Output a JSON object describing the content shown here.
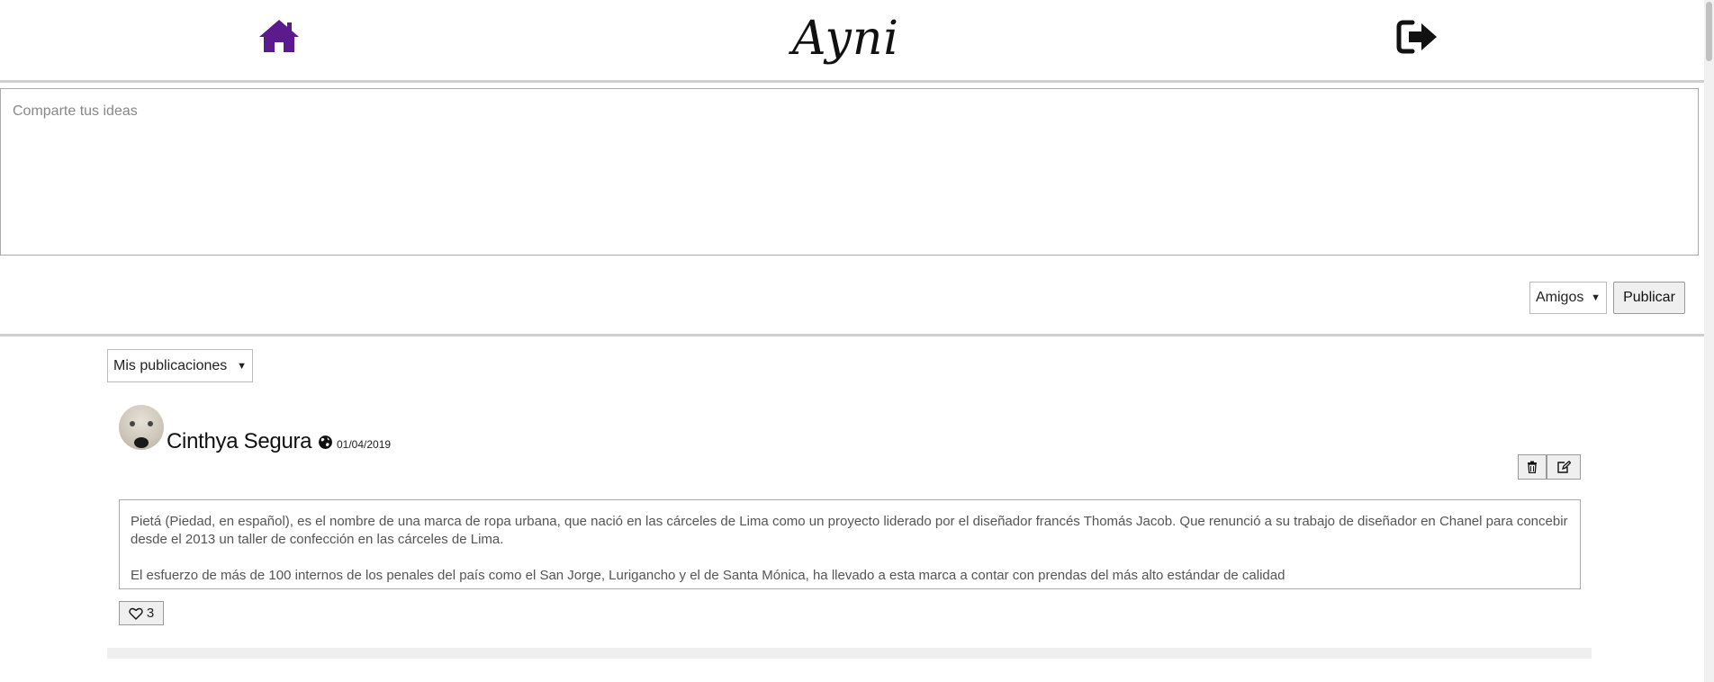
{
  "header": {
    "logo_text": "Ayni",
    "home_icon": "home-icon",
    "logout_icon": "sign-out-icon",
    "accent_color": "#5b1b8f"
  },
  "composer": {
    "placeholder": "Comparte tus ideas",
    "value": "",
    "privacy_selected": "Amigos",
    "publish_label": "Publicar"
  },
  "feed": {
    "filter_selected": "Mis publicaciones",
    "posts": [
      {
        "author": "Cinthya Segura",
        "visibility_icon": "globe-icon",
        "date": "01/04/2019",
        "paragraphs": [
          "Pietá (Piedad, en español), es el nombre de una marca de ropa urbana, que nació en las cárceles de Lima como un proyecto liderado por el diseñador francés Thomás Jacob. Que renunció a su trabajo de diseñador en Chanel para concebir desde el 2013 un taller de confección en las cárceles de Lima.",
          "El esfuerzo de más de 100 internos de los penales del país como el San Jorge, Lurigancho y el de Santa Mónica, ha llevado a esta marca a contar con prendas del más alto estándar de calidad"
        ],
        "likes": "3",
        "delete_icon": "trash-icon",
        "edit_icon": "edit-icon",
        "like_icon": "heart-icon"
      }
    ]
  }
}
